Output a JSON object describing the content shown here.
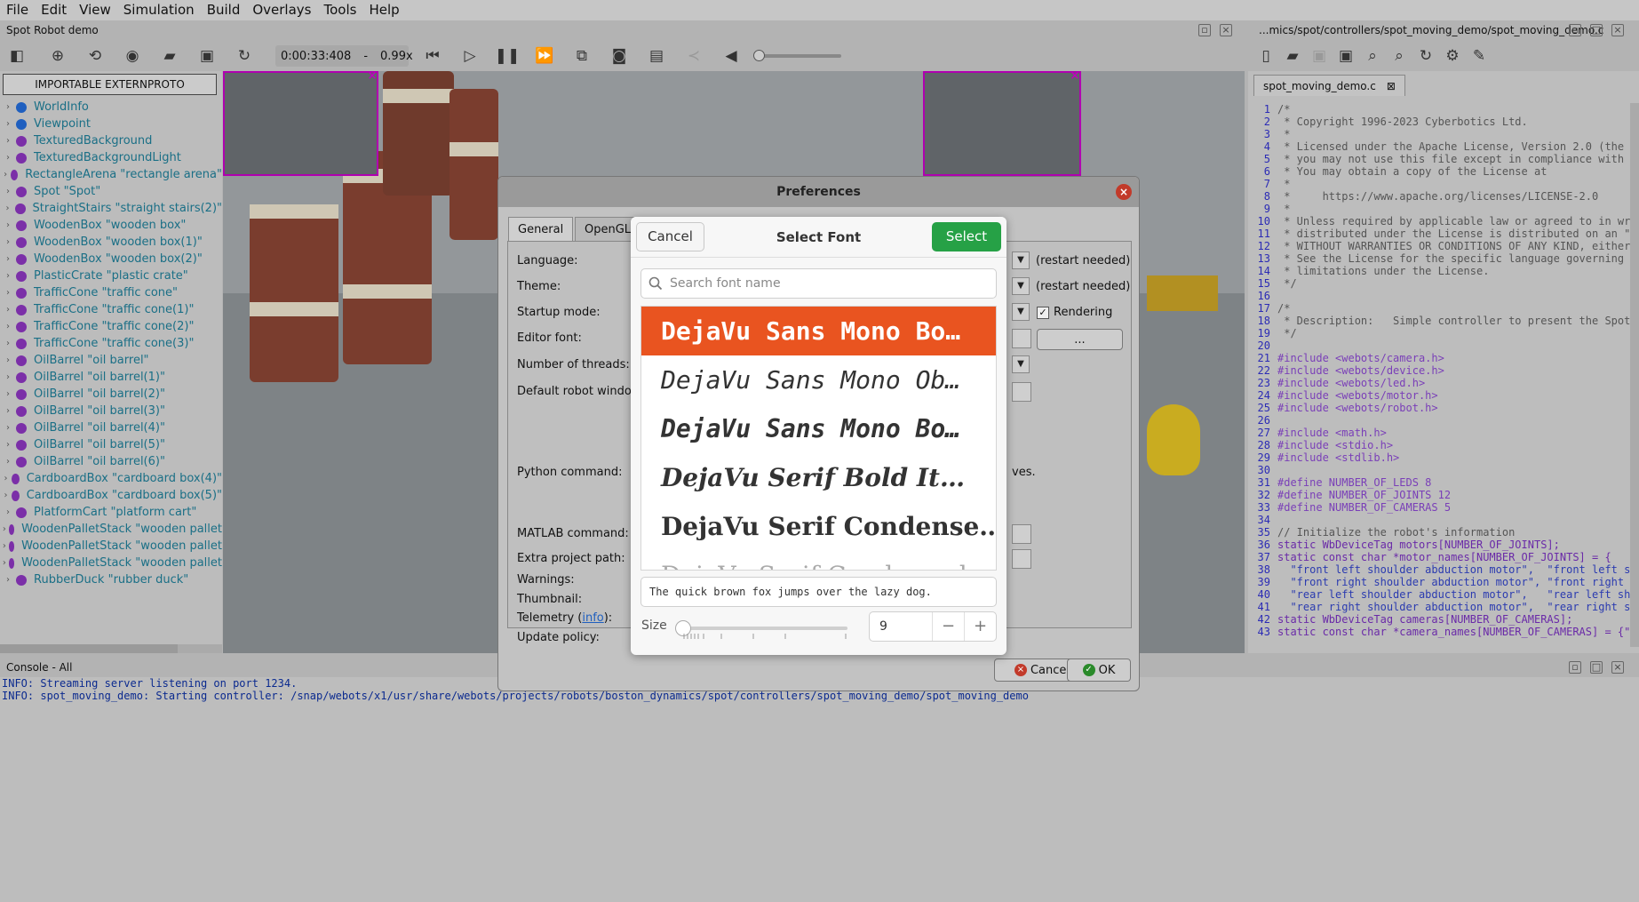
{
  "menu": [
    "File",
    "Edit",
    "View",
    "Simulation",
    "Build",
    "Overlays",
    "Tools",
    "Help"
  ],
  "window_title": "Spot Robot demo",
  "editor_path": "...mics/spot/controllers/spot_moving_demo/spot_moving_demo.c",
  "toolbar": {
    "time": "0:00:33:408",
    "speed_sep": "-",
    "speed": "0.99x"
  },
  "scene": {
    "proto_button": "IMPORTABLE EXTERNPROTO",
    "items": [
      {
        "label": "WorldInfo",
        "color": "#1f5fbf"
      },
      {
        "label": "Viewpoint",
        "color": "#1f5fbf"
      },
      {
        "label": "TexturedBackground",
        "color": "#7b2fa8"
      },
      {
        "label": "TexturedBackgroundLight",
        "color": "#7b2fa8"
      },
      {
        "label": "RectangleArena \"rectangle arena\"",
        "color": "#7b2fa8"
      },
      {
        "label": "Spot \"Spot\"",
        "color": "#7b2fa8"
      },
      {
        "label": "StraightStairs \"straight stairs(2)\"",
        "color": "#7b2fa8"
      },
      {
        "label": "WoodenBox \"wooden box\"",
        "color": "#7b2fa8"
      },
      {
        "label": "WoodenBox \"wooden box(1)\"",
        "color": "#7b2fa8"
      },
      {
        "label": "WoodenBox \"wooden box(2)\"",
        "color": "#7b2fa8"
      },
      {
        "label": "PlasticCrate \"plastic crate\"",
        "color": "#7b2fa8"
      },
      {
        "label": "TrafficCone \"traffic cone\"",
        "color": "#7b2fa8"
      },
      {
        "label": "TrafficCone \"traffic cone(1)\"",
        "color": "#7b2fa8"
      },
      {
        "label": "TrafficCone \"traffic cone(2)\"",
        "color": "#7b2fa8"
      },
      {
        "label": "TrafficCone \"traffic cone(3)\"",
        "color": "#7b2fa8"
      },
      {
        "label": "OilBarrel \"oil barrel\"",
        "color": "#7b2fa8"
      },
      {
        "label": "OilBarrel \"oil barrel(1)\"",
        "color": "#7b2fa8"
      },
      {
        "label": "OilBarrel \"oil barrel(2)\"",
        "color": "#7b2fa8"
      },
      {
        "label": "OilBarrel \"oil barrel(3)\"",
        "color": "#7b2fa8"
      },
      {
        "label": "OilBarrel \"oil barrel(4)\"",
        "color": "#7b2fa8"
      },
      {
        "label": "OilBarrel \"oil barrel(5)\"",
        "color": "#7b2fa8"
      },
      {
        "label": "OilBarrel \"oil barrel(6)\"",
        "color": "#7b2fa8"
      },
      {
        "label": "CardboardBox \"cardboard box(4)\"",
        "color": "#7b2fa8"
      },
      {
        "label": "CardboardBox \"cardboard box(5)\"",
        "color": "#7b2fa8"
      },
      {
        "label": "PlatformCart \"platform cart\"",
        "color": "#7b2fa8"
      },
      {
        "label": "WoodenPalletStack \"wooden pallet",
        "color": "#7b2fa8"
      },
      {
        "label": "WoodenPalletStack \"wooden pallet",
        "color": "#7b2fa8"
      },
      {
        "label": "WoodenPalletStack \"wooden pallet",
        "color": "#7b2fa8"
      },
      {
        "label": "RubberDuck \"rubber duck\"",
        "color": "#7b2fa8"
      }
    ]
  },
  "editor": {
    "tab": "spot_moving_demo.c",
    "lines": [
      {
        "n": "1",
        "t": "/*",
        "c": "cm"
      },
      {
        "n": "2",
        "t": " * Copyright 1996-2023 Cyberbotics Ltd.",
        "c": "cm"
      },
      {
        "n": "3",
        "t": " *",
        "c": "cm"
      },
      {
        "n": "4",
        "t": " * Licensed under the Apache License, Version 2.0 (the",
        "c": "cm"
      },
      {
        "n": "5",
        "t": " * you may not use this file except in compliance with",
        "c": "cm"
      },
      {
        "n": "6",
        "t": " * You may obtain a copy of the License at",
        "c": "cm"
      },
      {
        "n": "7",
        "t": " *",
        "c": "cm"
      },
      {
        "n": "8",
        "t": " *     https://www.apache.org/licenses/LICENSE-2.0",
        "c": "cm"
      },
      {
        "n": "9",
        "t": " *",
        "c": "cm"
      },
      {
        "n": "10",
        "t": " * Unless required by applicable law or agreed to in wr",
        "c": "cm"
      },
      {
        "n": "11",
        "t": " * distributed under the License is distributed on an \"",
        "c": "cm"
      },
      {
        "n": "12",
        "t": " * WITHOUT WARRANTIES OR CONDITIONS OF ANY KIND, either",
        "c": "cm"
      },
      {
        "n": "13",
        "t": " * See the License for the specific language governing",
        "c": "cm"
      },
      {
        "n": "14",
        "t": " * limitations under the License.",
        "c": "cm"
      },
      {
        "n": "15",
        "t": " */",
        "c": "cm"
      },
      {
        "n": "16",
        "t": "",
        "c": ""
      },
      {
        "n": "17",
        "t": "/*",
        "c": "cm"
      },
      {
        "n": "18",
        "t": " * Description:   Simple controller to present the Spot",
        "c": "cm"
      },
      {
        "n": "19",
        "t": " */",
        "c": "cm"
      },
      {
        "n": "20",
        "t": "",
        "c": ""
      },
      {
        "n": "21",
        "t": "#include <webots/camera.h>",
        "c": "pp"
      },
      {
        "n": "22",
        "t": "#include <webots/device.h>",
        "c": "pp"
      },
      {
        "n": "23",
        "t": "#include <webots/led.h>",
        "c": "pp"
      },
      {
        "n": "24",
        "t": "#include <webots/motor.h>",
        "c": "pp"
      },
      {
        "n": "25",
        "t": "#include <webots/robot.h>",
        "c": "pp"
      },
      {
        "n": "26",
        "t": "",
        "c": ""
      },
      {
        "n": "27",
        "t": "#include <math.h>",
        "c": "pp"
      },
      {
        "n": "28",
        "t": "#include <stdio.h>",
        "c": "pp"
      },
      {
        "n": "29",
        "t": "#include <stdlib.h>",
        "c": "pp"
      },
      {
        "n": "30",
        "t": "",
        "c": ""
      },
      {
        "n": "31",
        "t": "#define NUMBER_OF_LEDS 8",
        "c": "pp"
      },
      {
        "n": "32",
        "t": "#define NUMBER_OF_JOINTS 12",
        "c": "pp"
      },
      {
        "n": "33",
        "t": "#define NUMBER_OF_CAMERAS 5",
        "c": "pp"
      },
      {
        "n": "34",
        "t": "",
        "c": ""
      },
      {
        "n": "35",
        "t": "// Initialize the robot's information",
        "c": "cm"
      },
      {
        "n": "36",
        "t": "static WbDeviceTag motors[NUMBER_OF_JOINTS];",
        "c": "kw"
      },
      {
        "n": "37",
        "t": "static const char *motor_names[NUMBER_OF_JOINTS] = {",
        "c": "kw"
      },
      {
        "n": "38",
        "t": "  \"front left shoulder abduction motor\",  \"front left s",
        "c": "st"
      },
      {
        "n": "39",
        "t": "  \"front right shoulder abduction motor\", \"front right",
        "c": "st"
      },
      {
        "n": "40",
        "t": "  \"rear left shoulder abduction motor\",   \"rear left sh",
        "c": "st"
      },
      {
        "n": "41",
        "t": "  \"rear right shoulder abduction motor\",  \"rear right s",
        "c": "st"
      },
      {
        "n": "42",
        "t": "static WbDeviceTag cameras[NUMBER_OF_CAMERAS];",
        "c": "kw"
      },
      {
        "n": "43",
        "t": "static const char *camera_names[NUMBER_OF_CAMERAS] = {\"",
        "c": "kw"
      }
    ]
  },
  "console": {
    "title": "Console - All",
    "lines": [
      "INFO: Streaming server listening on port 1234.",
      "INFO: spot_moving_demo: Starting controller: /snap/webots/x1/usr/share/webots/projects/robots/boston_dynamics/spot/controllers/spot_moving_demo/spot_moving_demo"
    ]
  },
  "preferences": {
    "title": "Preferences",
    "tabs": [
      "General",
      "OpenGL"
    ],
    "labels": {
      "language": "Language:",
      "theme": "Theme:",
      "startup": "Startup mode:",
      "editor_font": "Editor font:",
      "threads": "Number of threads:",
      "robot_window": "Default robot window",
      "python": "Python command:",
      "matlab": "MATLAB command:",
      "extra_path": "Extra project path:",
      "warnings": "Warnings:",
      "thumbnail": "Thumbnail:",
      "telemetry_pre": "Telemetry (",
      "telemetry_link": "info",
      "telemetry_post": "):",
      "update": "Update policy:"
    },
    "restart1": "(restart needed)",
    "restart2": "(restart needed)",
    "rendering": "Rendering",
    "font_btn": "...",
    "python_tail": "ves.",
    "cancel": "Cancel",
    "ok": "OK"
  },
  "font_dialog": {
    "title": "Select Font",
    "cancel": "Cancel",
    "select": "Select",
    "search_placeholder": "Search font name",
    "fonts": [
      "DejaVu Sans Mono Bo…",
      "DejaVu Sans Mono Ob…",
      "DejaVu Sans Mono Bo…",
      "DejaVu Serif Bold It…",
      "DejaVu Serif Condense…",
      "DejaVu Serif Condensed"
    ],
    "preview": "The quick brown fox jumps over the lazy dog.",
    "size_label": "Size",
    "size_value": "9",
    "minus": "−",
    "plus": "+"
  },
  "colors": {
    "accent": "#e95420",
    "select_green": "#26a146",
    "magenta": "#b000b0"
  }
}
